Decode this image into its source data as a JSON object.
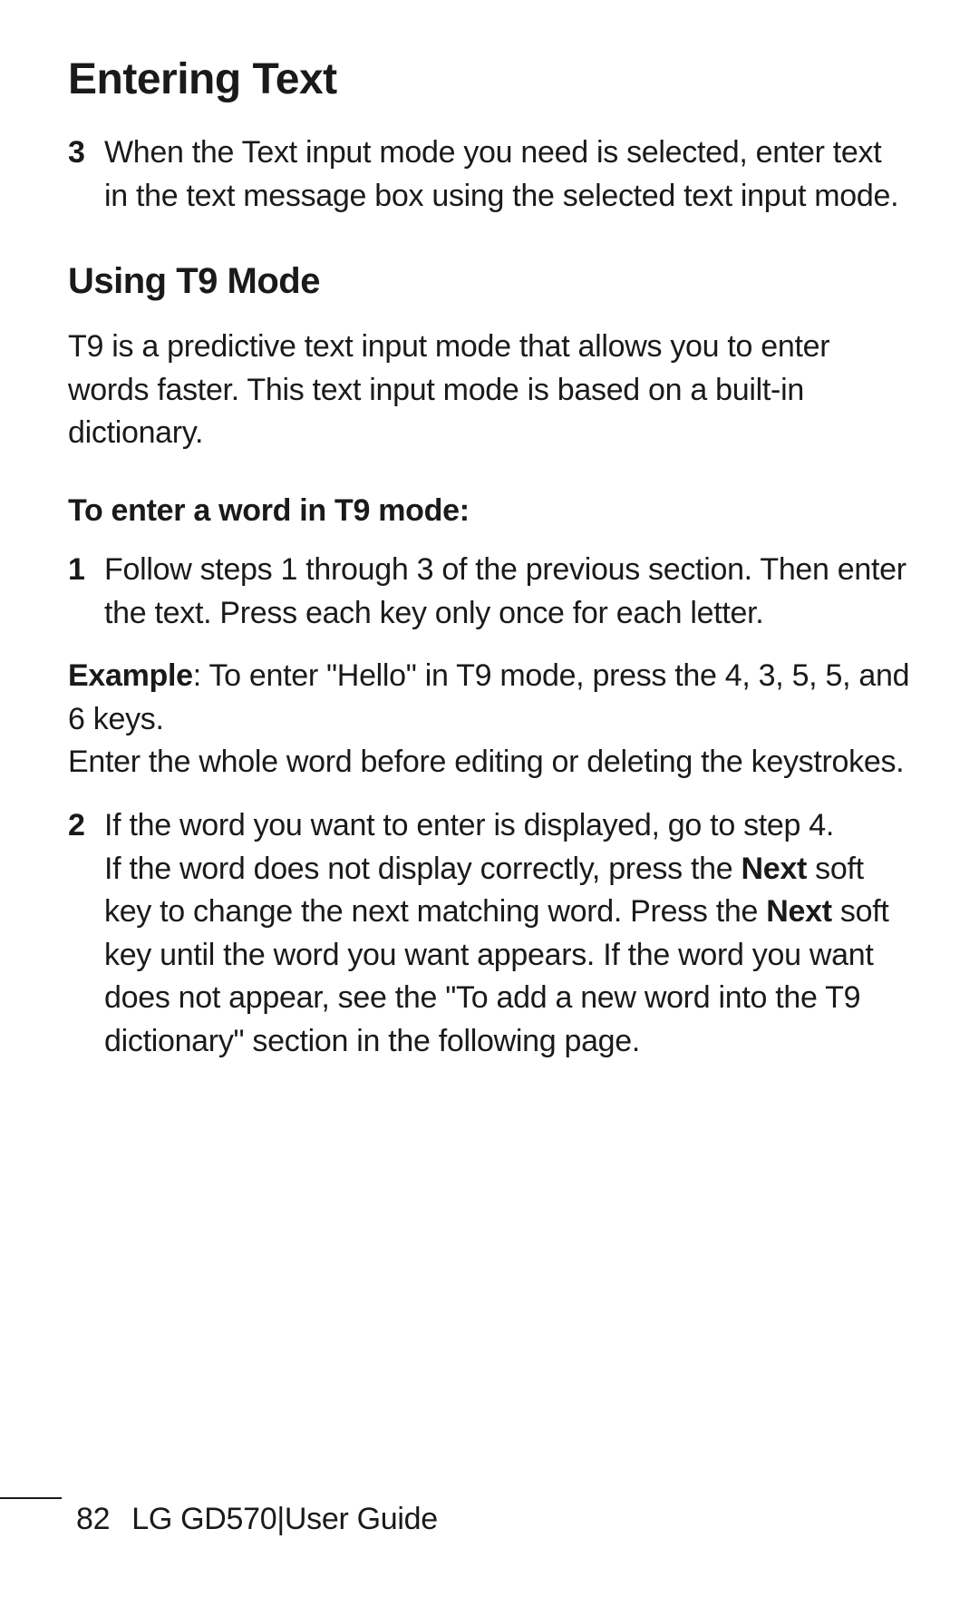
{
  "title": "Entering Text",
  "step3": {
    "num": "3",
    "text": "When the Text input mode you need is selected, enter text in the text message box using the selected text input mode."
  },
  "section2": {
    "heading": "Using T9 Mode",
    "intro": "T9 is a predictive text input mode that allows you to enter words faster. This text input mode is based on a built-in dictionary.",
    "subheading": "To enter a word in T9 mode:",
    "step1": {
      "num": "1",
      "text": "Follow steps 1 through 3 of the previous section. Then enter the text. Press each key only once for each letter."
    },
    "example_label": "Example",
    "example_text": ": To enter \"Hello\" in T9 mode, press the 4, 3, 5, 5, and 6 keys.",
    "example_line2": "Enter the whole word before editing or deleting the keystrokes.",
    "step2": {
      "num": "2",
      "line1": "If the word you want to enter is displayed, go to step 4.",
      "line2a": "If the word does not display correctly, press the ",
      "next1": "Next",
      "line2b": " soft key to change the next matching word. Press the ",
      "next2": "Next",
      "line2c": " soft key until the word you want appears. If the word you want does not appear, see the \"To add a new word into the T9 dictionary\" section in the following page."
    }
  },
  "footer": {
    "page": "82",
    "product": "LG GD570",
    "sep": "  |  ",
    "guide": "User Guide"
  }
}
